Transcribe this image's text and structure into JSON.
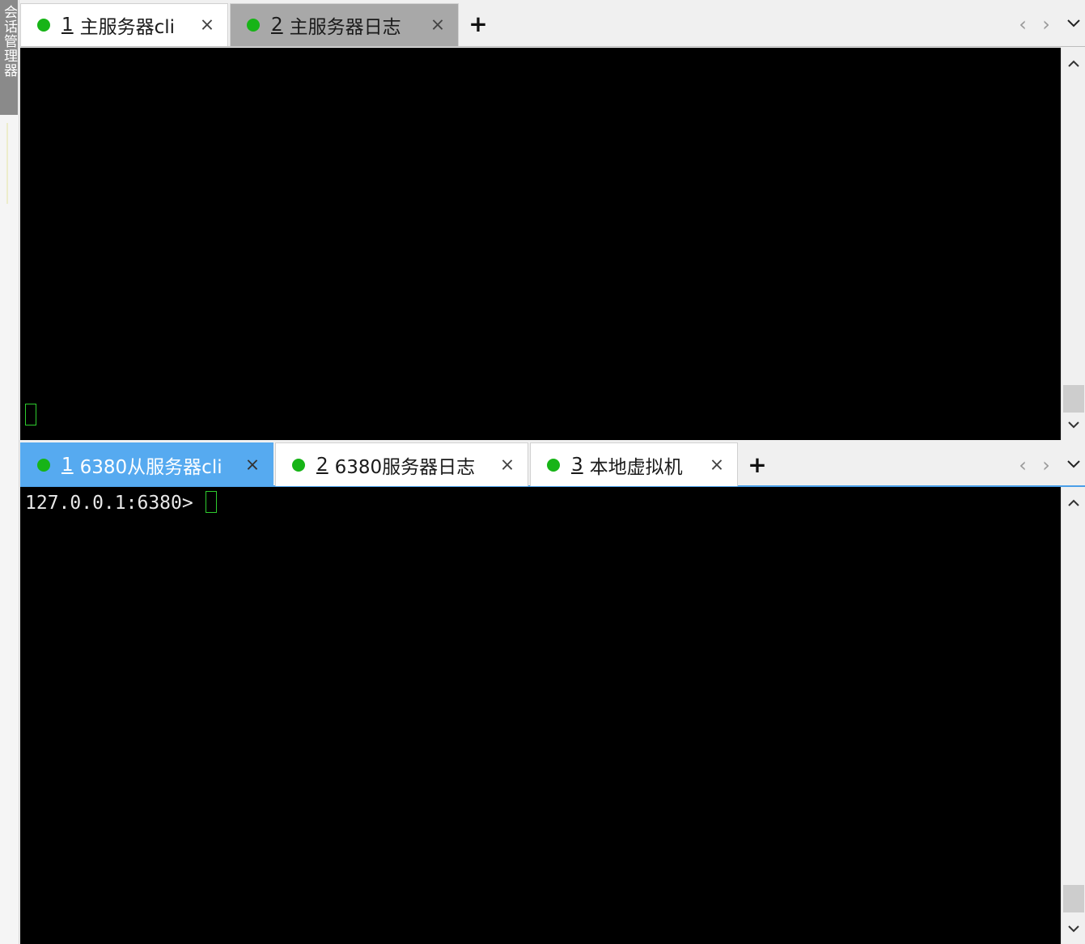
{
  "side_panel": {
    "label": "会话管理器"
  },
  "top_pane": {
    "tabs": [
      {
        "num": "1",
        "label": "主服务器cli",
        "state": "active",
        "close": "×"
      },
      {
        "num": "2",
        "label": "主服务器日志",
        "state": "inactive",
        "close": "×"
      }
    ],
    "add_label": "+",
    "nav_prev": "‹",
    "nav_next": "›",
    "terminal_text": ""
  },
  "bottom_pane": {
    "tabs": [
      {
        "num": "1",
        "label": "6380从服务器cli",
        "state": "selected",
        "close": "×"
      },
      {
        "num": "2",
        "label": "6380服务器日志",
        "state": "active",
        "close": "×"
      },
      {
        "num": "3",
        "label": "本地虚拟机",
        "state": "active",
        "close": "×"
      }
    ],
    "add_label": "+",
    "nav_prev": "‹",
    "nav_next": "›",
    "terminal_prompt": "127.0.0.1:6380> "
  },
  "colors": {
    "status_dot": "#17b417",
    "selected_tab": "#56aaf0",
    "cursor": "#2ecc2e",
    "terminal_bg": "#000000"
  },
  "icons": {
    "status": "status-dot-icon",
    "close": "close-icon",
    "add": "plus-icon",
    "prev": "chevron-left-icon",
    "next": "chevron-right-icon",
    "menu": "chevron-down-icon",
    "scroll_up": "scroll-up-icon",
    "scroll_down": "scroll-down-icon"
  }
}
